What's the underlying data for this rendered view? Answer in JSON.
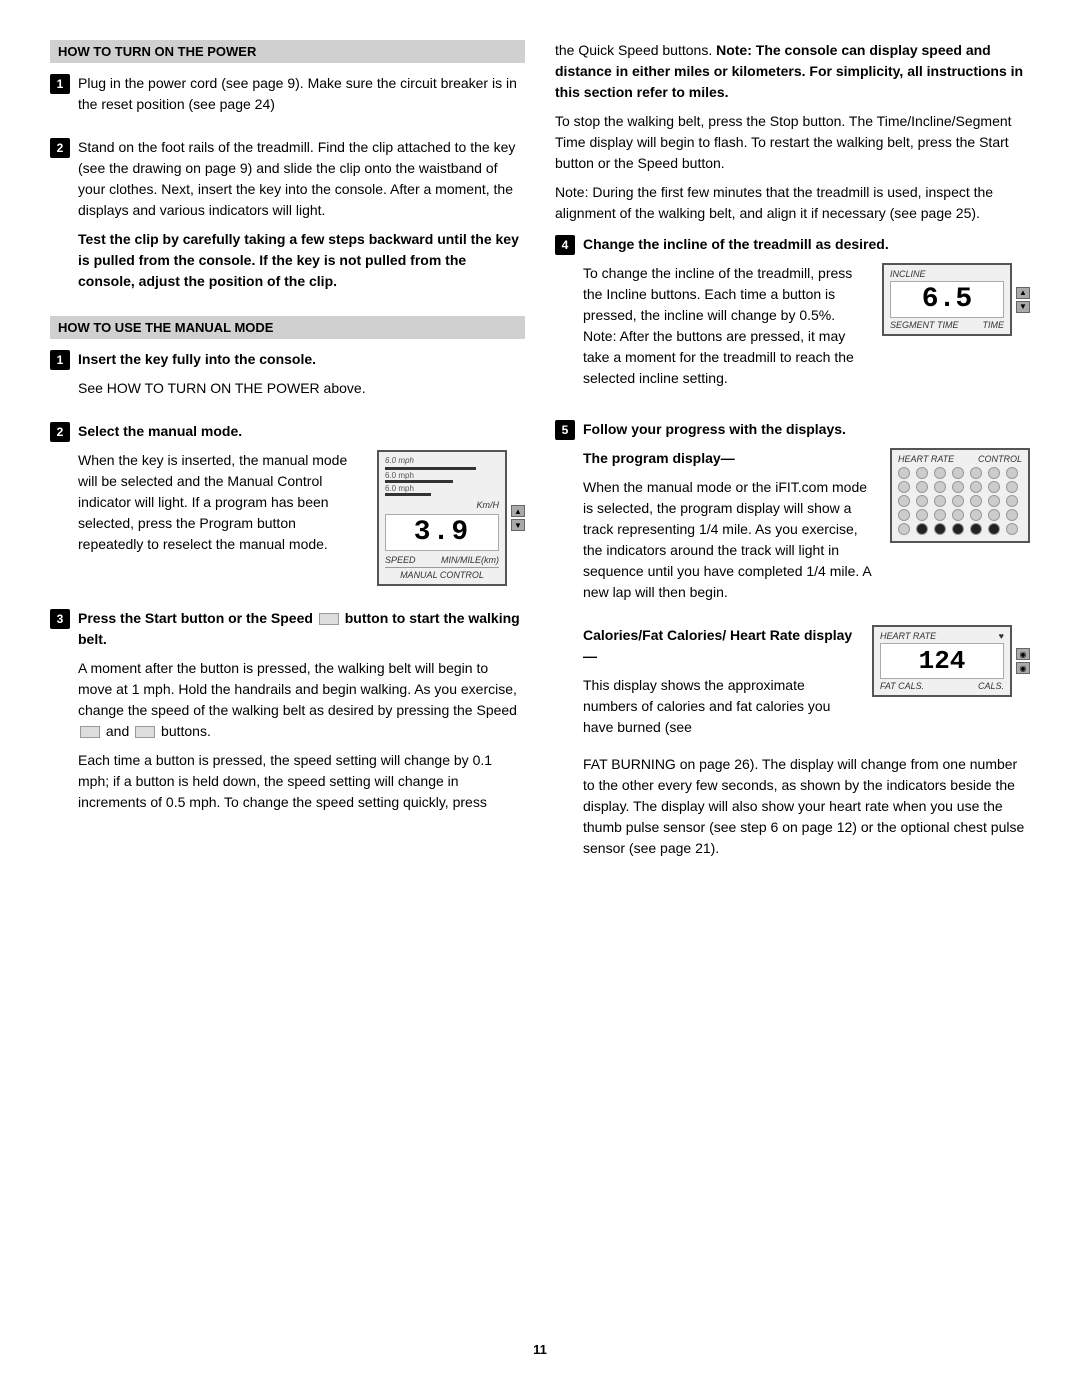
{
  "page": {
    "number": "11"
  },
  "left": {
    "section1": {
      "header": "HOW TO TURN ON THE POWER",
      "step1": {
        "num": "1",
        "text": "Plug in the power cord (see page 9). Make sure the circuit breaker is in the reset position (see page 24)"
      },
      "step2": {
        "num": "2",
        "text1": "Stand on the foot rails of the treadmill. Find the clip attached to the key (see the drawing on page 9) and slide the clip onto the waistband of your clothes. Next, insert the key into the console. After a moment, the displays and various indicators will light.",
        "text2_bold": "Test the clip by carefully taking a few steps backward until the key is pulled from the console. If the key is not pulled from the console, adjust the position of the clip."
      }
    },
    "section2": {
      "header": "HOW TO USE THE MANUAL MODE",
      "step1": {
        "num": "1",
        "bold": "Insert the key fully into the console.",
        "text": "See HOW TO TURN ON THE POWER above."
      },
      "step2": {
        "num": "2",
        "bold": "Select the manual mode.",
        "text1": "When the key is inserted, the manual mode will be selected and the Manual Control indicator will light. If a program has been selected, press the Program button repeatedly to reselect the manual mode.",
        "speed_display": {
          "top_label": "Km/H",
          "value": "3.9",
          "label_left": "SPEED",
          "label_right": "MIN/MILE(km)",
          "bars": [
            {
              "label": "6.0 mph"
            },
            {
              "label": "6.0 mph"
            },
            {
              "label": "6.0 mph"
            }
          ],
          "manual_control": "MANUAL CONTROL"
        }
      },
      "step3": {
        "num": "3",
        "bold1": "Press the Start button or the Speed",
        "bold2": "button to start the walking belt.",
        "text1": "A moment after the button is pressed, the walking belt will begin to move at 1 mph. Hold the handrails and begin walking. As you exercise, change the speed of the walking belt as desired by pressing the Speed",
        "text2": "and",
        "text3": "buttons.",
        "text4": "Each time a button is pressed, the speed setting will change by 0.1 mph; if a button is held down, the speed setting will change in increments of 0.5 mph. To change the speed setting quickly, press"
      }
    }
  },
  "right": {
    "intro": {
      "text1": "the Quick Speed buttons.",
      "bold1": "Note: The console can display speed and distance in either miles or kilometers. For simplicity, all instructions in this section refer to miles.",
      "text2": "To stop the walking belt, press the Stop button. The Time/Incline/Segment Time display will begin to flash. To restart the walking belt, press the Start button or the Speed    button.",
      "note": "Note: During the first few minutes that the treadmill is used, inspect the alignment of the walking belt, and align it if necessary (see page 25)."
    },
    "step4": {
      "num": "4",
      "bold": "Change the incline of the treadmill as desired.",
      "text": "To change the incline of the treadmill, press the Incline buttons. Each time a button is pressed, the incline will change by 0.5%. Note: After the buttons are pressed, it may take a moment for the treadmill to reach the selected incline setting.",
      "incline_display": {
        "top_label": "INCLINE",
        "value": "6.5",
        "label_left": "SEGMENT TIME",
        "label_right": "TIME"
      }
    },
    "step5": {
      "num": "5",
      "bold": "Follow your progress with the displays.",
      "program_display": {
        "header_label": "HEART RATE",
        "header_label2": "CONTROL",
        "dots": [
          [
            false,
            false,
            false,
            false,
            false,
            false,
            false
          ],
          [
            false,
            false,
            false,
            false,
            false,
            false,
            false
          ],
          [
            false,
            false,
            false,
            false,
            false,
            false,
            false
          ],
          [
            false,
            false,
            false,
            false,
            false,
            false,
            false
          ],
          [
            false,
            false,
            false,
            false,
            false,
            false,
            false
          ]
        ],
        "title": "The program display—",
        "text": "When the manual mode or the iFIT.com mode is selected, the program display will show a track representing 1/4 mile. As you exercise, the indicators around the track will light in sequence until you have completed 1/4 mile. A new lap will then begin."
      },
      "calories_display": {
        "top_label": "HEART RATE",
        "heart_symbol": "♥",
        "value": "124",
        "label_left": "FAT CALS.",
        "label_right": "CALS.",
        "title": "Calories/Fat Calories/ Heart Rate display—",
        "text1": "This display shows the approximate numbers of calories and fat calories you have burned (see",
        "text2": "FAT BURNING on page 26). The display will change from one number to the other every few seconds, as shown by the indicators beside the display. The display will also show your heart rate when you use the thumb pulse sensor (see step 6 on page 12) or the optional chest pulse sensor (see page 21)."
      }
    }
  }
}
